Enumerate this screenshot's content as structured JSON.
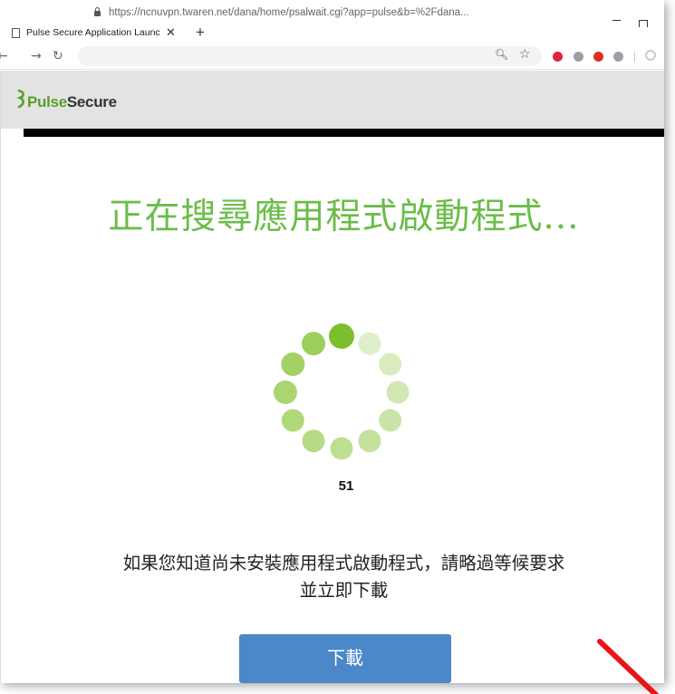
{
  "browser": {
    "tab_title": "Pulse Secure Application Launc",
    "tab_close": "✕",
    "new_tab": "+",
    "url": "https://ncnuvpn.twaren.net/dana/home/psalwait.cgi?app=pulse&b=%2Fdana...",
    "extension_colors": [
      "#e0243a",
      "#9aa0a6",
      "#d93025",
      "#9aa0a6"
    ]
  },
  "header": {
    "logo_pulse": "Pulse",
    "logo_secure": "Secure"
  },
  "main": {
    "heading": "正在搜尋應用程式啟動程式...",
    "countdown": "51",
    "info_line1": "如果您知道尚未安裝應用程式啟動程式，請略過等候要求",
    "info_line2": "並立即下載",
    "download_label": "下載"
  },
  "colors": {
    "brand_green": "#6bbd4a",
    "button_blue": "#4a88c9",
    "annotation_red": "#e8141a"
  }
}
